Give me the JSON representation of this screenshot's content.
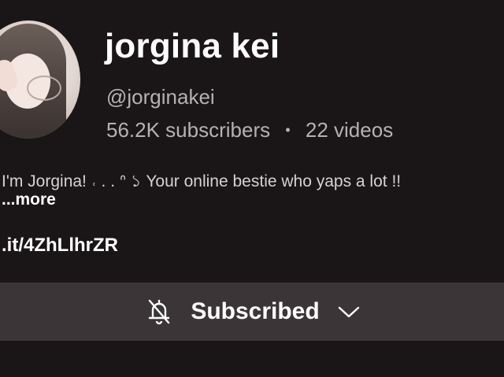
{
  "channel": {
    "name": "jorgina kei",
    "handle": "@jorginakei",
    "subscribers": "56.2K subscribers",
    "separator": "•",
    "videos": "22 videos"
  },
  "bio": {
    "text": "I'm Jorgina! ˓ . . ᐢ ১ Your online bestie who yaps a lot !!",
    "more_label": "...more"
  },
  "link": {
    "text": ".it/4ZhLlhrZR"
  },
  "subscribe": {
    "label": "Subscribed",
    "bell_icon": "bell-off-icon",
    "chevron_icon": "chevron-down-icon"
  },
  "colors": {
    "background": "#1a1618",
    "button_background": "#3b3537",
    "secondary_text": "#b6b1b3"
  }
}
